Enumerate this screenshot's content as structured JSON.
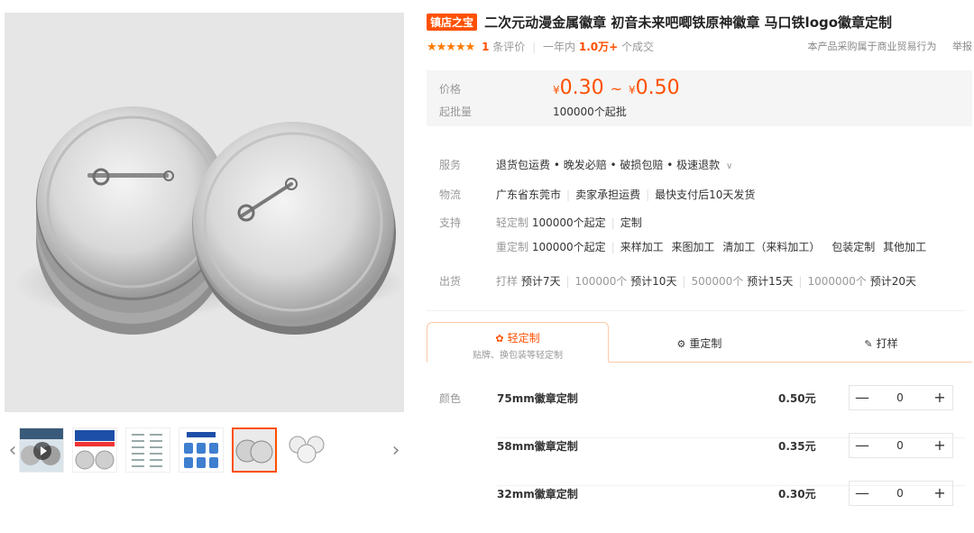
{
  "product": {
    "shop_badge": "镇店之宝",
    "title": "二次元动漫金属徽章 初音未来吧唧铁原神徽章 马口铁logo徽章定制"
  },
  "rating": {
    "stars": "★★★★★",
    "review_count": "1",
    "review_label": "条评价",
    "sold_prefix": "一年内",
    "sold_count": "1.0万+",
    "sold_suffix": "个成交",
    "notice": "本产品采购属于商业贸易行为",
    "report": "举报"
  },
  "price": {
    "label": "价格",
    "currency": "¥",
    "low": "0.30",
    "tilde": "~",
    "high": "0.50",
    "moq_label": "起批量",
    "moq_value": "100000个起批"
  },
  "service": {
    "label": "服务",
    "value": "退货包运费 • 晚发必赔 • 破损包赔 • 极速退款",
    "chevron": "∨"
  },
  "logistics": {
    "label": "物流",
    "location": "广东省东莞市",
    "freight": "卖家承担运费",
    "ship": "最快支付后10天发货"
  },
  "support": {
    "label": "支持",
    "light_label": "轻定制",
    "light_min": "100000个起定",
    "light_items": [
      "定制"
    ],
    "heavy_label": "重定制",
    "heavy_min": "100000个起定",
    "heavy_items": [
      "来样加工",
      "来图加工",
      "清加工（来料加工）",
      "包装定制",
      "其他加工"
    ]
  },
  "shipping": {
    "label": "出货",
    "entries": [
      {
        "qty": "打样",
        "time": "预计7天"
      },
      {
        "qty": "100000个",
        "time": "预计10天"
      },
      {
        "qty": "500000个",
        "time": "预计15天"
      },
      {
        "qty": "1000000个",
        "time": "预计20天"
      }
    ]
  },
  "tabs": [
    {
      "label": "轻定制",
      "sub": "贴牌、换包装等轻定制",
      "icon": "✿"
    },
    {
      "label": "重定制",
      "icon": "⚙"
    },
    {
      "label": "打样",
      "icon": "✎"
    }
  ],
  "sku": {
    "label": "颜色",
    "rows": [
      {
        "name": "75mm徽章定制",
        "price": "0.50元",
        "qty": "0"
      },
      {
        "name": "58mm徽章定制",
        "price": "0.35元",
        "qty": "0"
      },
      {
        "name": "32mm徽章定制",
        "price": "0.30元",
        "qty": "0"
      }
    ],
    "minus": "—",
    "plus": "+"
  },
  "gallery": {
    "prev": "‹",
    "next": "›"
  }
}
